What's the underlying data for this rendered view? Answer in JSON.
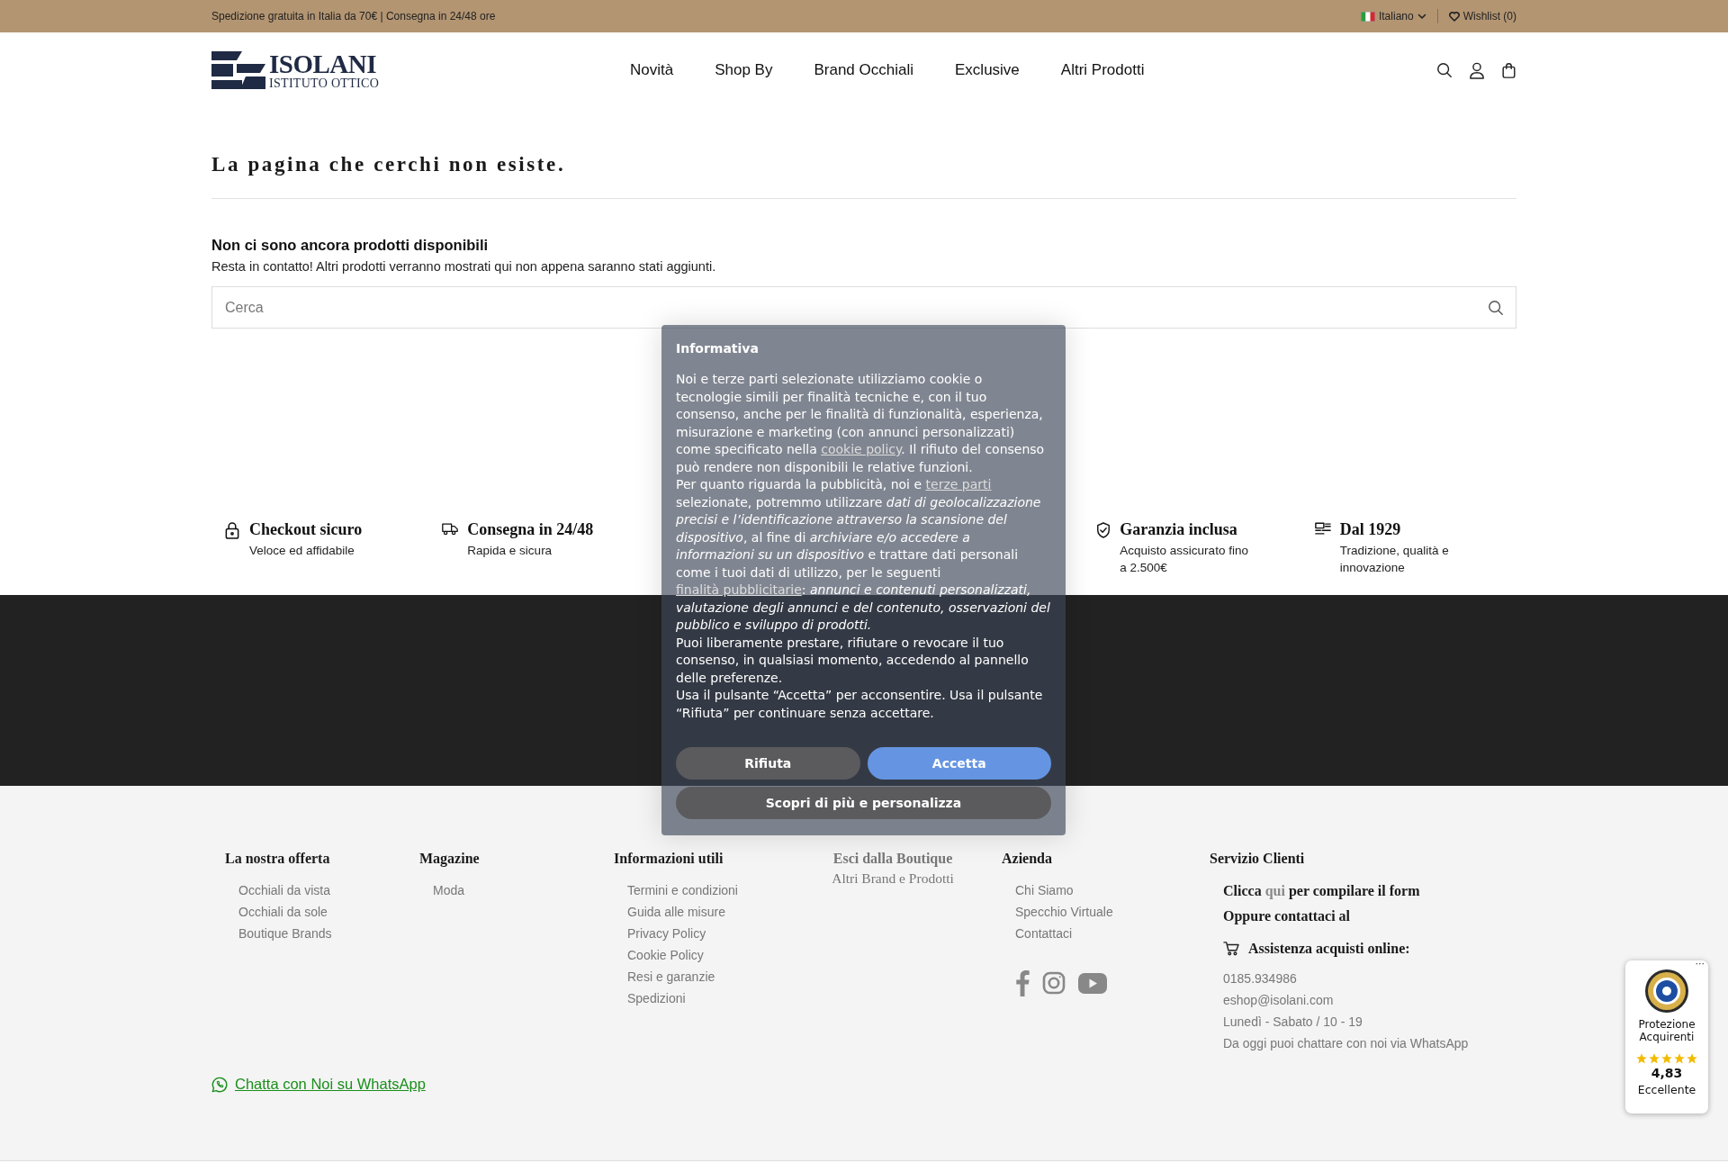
{
  "top_bar": {
    "shipping_text": "Spedizione gratuita in Italia da 70€ | Consegna in 24/48 ore",
    "language": "Italiano",
    "wishlist": "Wishlist (0)"
  },
  "header": {
    "logo_title": "ISOLANI",
    "logo_subtitle": "ISTITUTO OTTICO",
    "nav": [
      "Novità",
      "Shop By",
      "Brand Occhiali",
      "Exclusive",
      "Altri Prodotti"
    ]
  },
  "page": {
    "title": "La pagina che cerchi non esiste.",
    "empty_heading": "Non ci sono ancora prodotti disponibili",
    "empty_text": "Resta in contatto! Altri prodotti verranno mostrati qui non appena saranno stati aggiunti.",
    "search": {
      "placeholder": "Cerca"
    }
  },
  "features": [
    {
      "kind": "lock",
      "title": "Checkout sicuro",
      "text": "Veloce ed affidabile"
    },
    {
      "kind": "truck",
      "title": "Consegna in 24/48",
      "text": "Rapida e sicura"
    },
    {
      "kind": "shield",
      "title": "Garanzia inclusa",
      "text": "Acquisto assicurato fino a 2.500€"
    },
    {
      "kind": "history",
      "title": "Dal 1929",
      "text": "Tradizione, qualità e innovazione"
    }
  ],
  "footer": {
    "columns": [
      {
        "kind": "links",
        "heading": "La nostra offerta",
        "links": [
          "Occhiali da vista",
          "Occhiali da sole",
          "Boutique Brands"
        ]
      },
      {
        "kind": "links",
        "heading": "Magazine",
        "links": [
          "Moda"
        ]
      },
      {
        "kind": "links",
        "heading": "Informazioni utili",
        "links": [
          "Termini e condizioni",
          "Guida alle misure",
          "Privacy Policy",
          "Cookie Policy",
          "Resi e garanzie",
          "Spedizioni"
        ]
      },
      {
        "kind": "boutique",
        "heading": "Esci dalla Boutique",
        "links": [
          "Altri Brand e Prodotti"
        ]
      },
      {
        "kind": "company",
        "heading": "Azienda",
        "links": [
          "Chi Siamo",
          "Specchio Virtuale",
          "Contattaci"
        ]
      }
    ],
    "customer_service": {
      "heading": "Servizio Clienti",
      "form_prefix": "Clicca",
      "form_link": "qui",
      "form_suffix": "per compilare il form",
      "contact_line": "Oppure contattaci al",
      "assist": "Assistenza acquisti online:",
      "details": [
        "0185.934986",
        "eshop@isolani.com",
        "Lunedì - Sabato / 10 - 19",
        "Da oggi puoi chattare con noi via WhatsApp"
      ]
    },
    "whatsapp_link": "Chatta con Noi su WhatsApp"
  },
  "consent": {
    "title": "Informativa",
    "paragraphs": [
      [
        {
          "kind": "text",
          "text": "Noi e terze parti selezionate utilizziamo cookie o tecnologie simili per finalità tecniche e, con il tuo consenso, anche per le finalità di funzionalità, esperienza, misurazione e marketing (con annunci personalizzati) come specificato nella "
        },
        {
          "kind": "link",
          "text": "cookie policy"
        },
        {
          "kind": "text",
          "text": ". Il rifiuto del consenso può rendere non disponibili le relative funzioni."
        }
      ],
      [
        {
          "kind": "text",
          "text": "Per quanto riguarda la pubblicità, noi e "
        },
        {
          "kind": "link",
          "text": "terze parti"
        },
        {
          "kind": "text",
          "text": " selezionate, potremmo utilizzare *dati di geolocalizzazione precisi e l’identificazione attraverso la scansione del dispositivo*, al fine di *archiviare e/o accedere a informazioni su un dispositivo* e trattare dati personali come i tuoi dati di utilizzo, per le seguenti "
        },
        {
          "kind": "link",
          "text": "finalità pubblicitarie"
        },
        {
          "kind": "text",
          "text": ": *annunci e contenuti personalizzati, valutazione degli annunci e del contenuto, osservazioni del pubblico e sviluppo di prodotti.*"
        }
      ],
      [
        {
          "kind": "text",
          "text": "Puoi liberamente prestare, rifiutare o revocare il tuo consenso, in qualsiasi momento, accedendo al pannello delle preferenze."
        }
      ],
      [
        {
          "kind": "text",
          "text": "Usa il pulsante “Accetta” per acconsentire. Usa il pulsante “Rifiuta” per continuare senza accettare."
        }
      ]
    ],
    "buttons": [
      {
        "kind": "reject",
        "label": "Rifiuta"
      },
      {
        "kind": "accept",
        "label": "Accetta"
      },
      {
        "kind": "customize",
        "label": "Scopri di più e personalizza"
      }
    ]
  },
  "trust_badge": {
    "menu_glyph": "···",
    "label": "Protezione Acquirenti",
    "stars": 5,
    "rating": "4,83",
    "verdict": "Eccellente"
  }
}
